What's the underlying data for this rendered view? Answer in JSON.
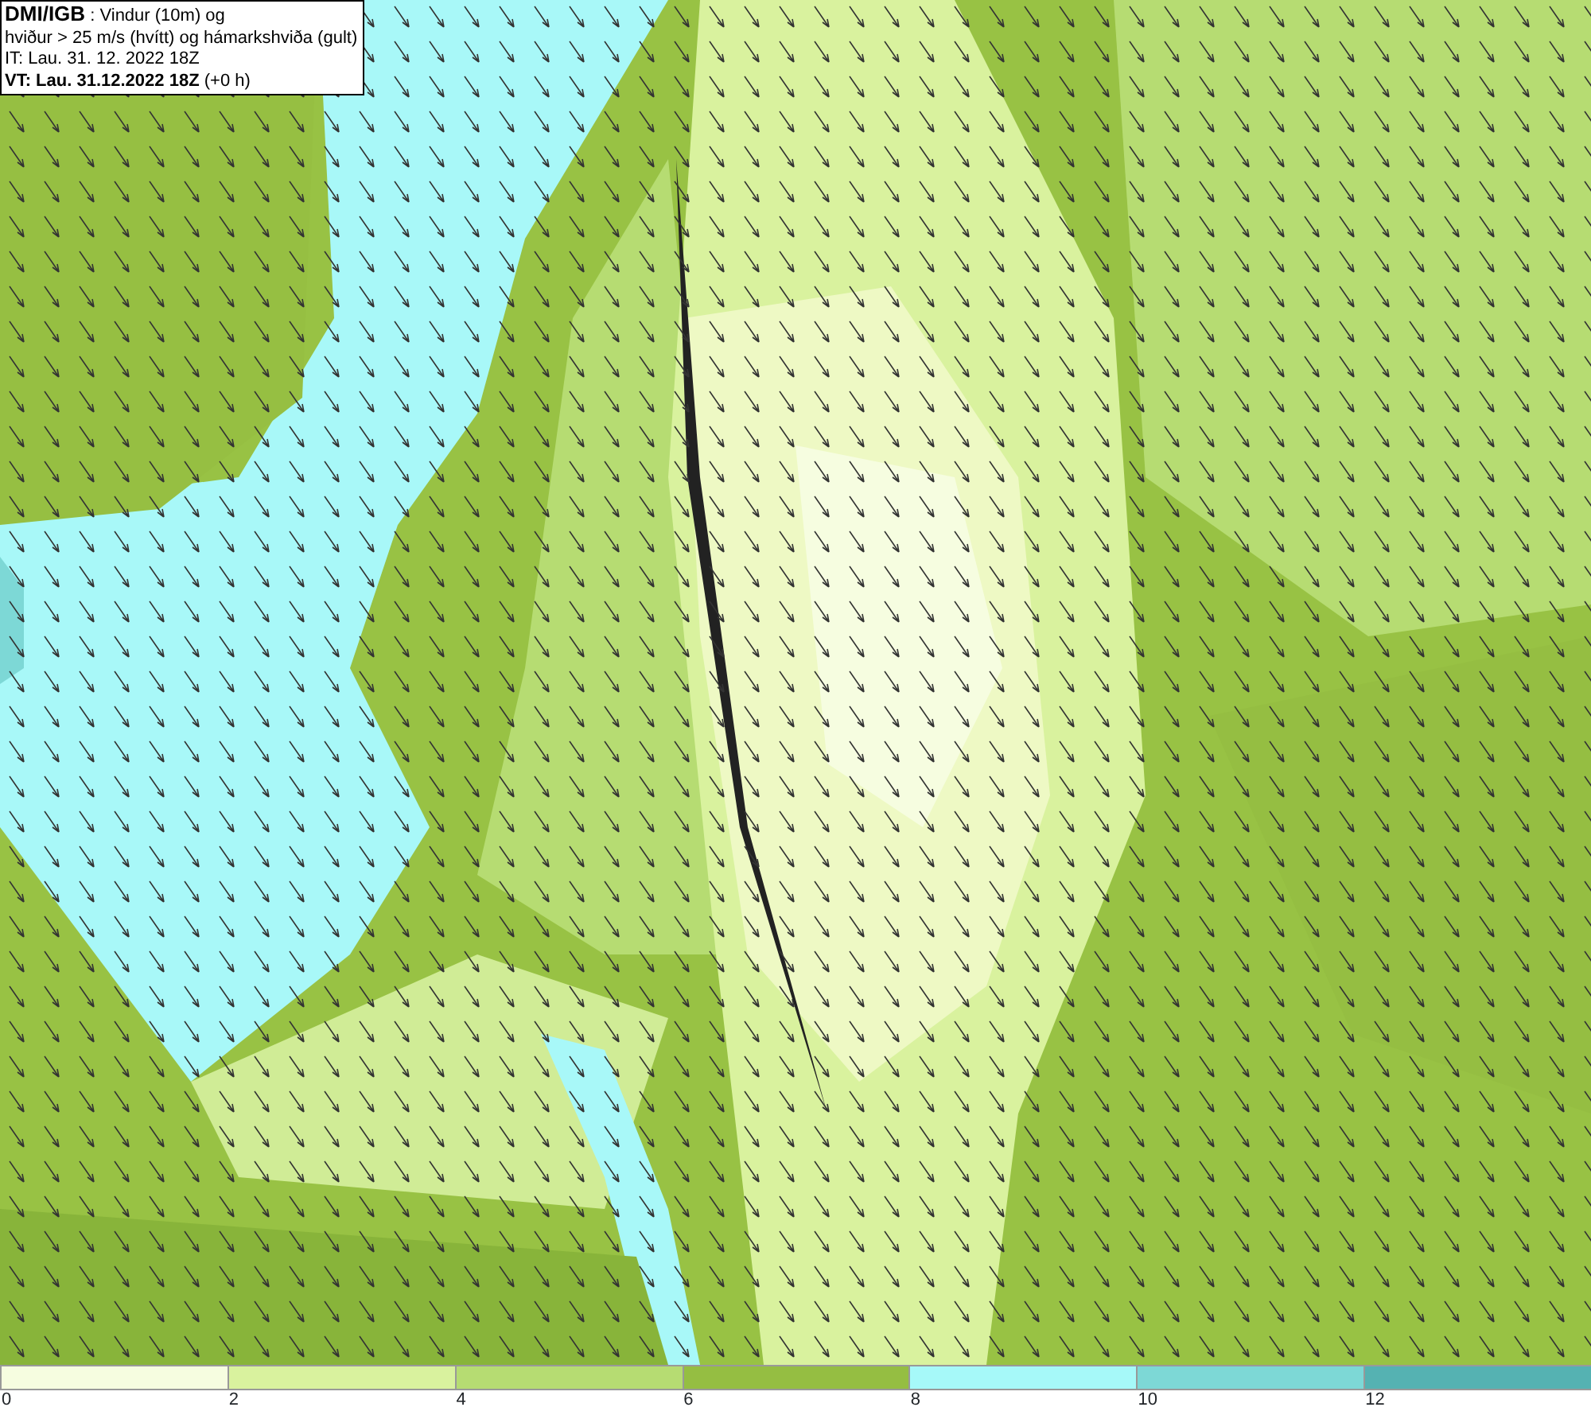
{
  "header": {
    "lines": [
      "**DMI/IGB** : Vindur (10m) og",
      "hviður > 25 m/s (hvítt) og hámarkshviða (gult)",
      "IT: Lau. 31. 12. 2022 18Z",
      "**VT: Lau. 31.12.2022 18Z** (+0 h)"
    ]
  },
  "legend": {
    "bins": [
      {
        "label": "0",
        "color": "#f6fde0"
      },
      {
        "label": "2",
        "color": "#d9f29e"
      },
      {
        "label": "4",
        "color": "#b6dc72"
      },
      {
        "label": "6",
        "color": "#95be42"
      },
      {
        "label": "8",
        "color": "#a6f9f9"
      },
      {
        "label": "10",
        "color": "#7dd8d6"
      },
      {
        "label": "12",
        "color": "#55b2b2"
      }
    ]
  }
}
